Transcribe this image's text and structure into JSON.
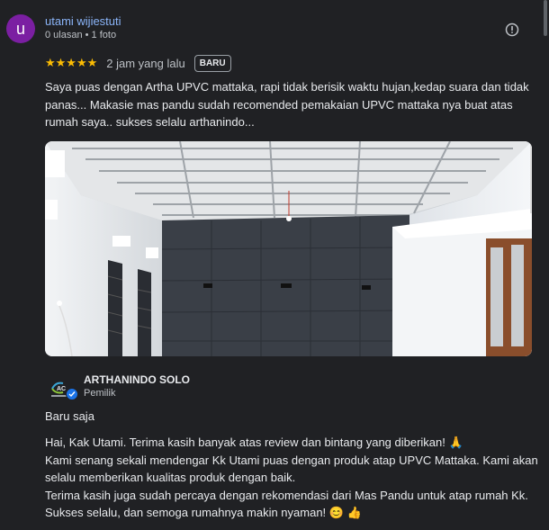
{
  "review": {
    "avatar_letter": "u",
    "reviewer_name": "utami wijiestuti",
    "reviewer_meta": "0 ulasan • 1 foto",
    "stars": "★★★★★",
    "rating": 5,
    "time_ago": "2 jam yang lalu",
    "badge": "BARU",
    "text": "Saya puas dengan Artha UPVC mattaka, rapi tidak berisik waktu hujan,kedap suara dan tidak panas... Makasie mas pandu sudah recomended pemakaian UPVC mattaka nya buat atas rumah saya.. sukses selalu arthanindo...",
    "more_icon": "info-circle-icon"
  },
  "owner_reply": {
    "name": "ARTHANINDO SOLO",
    "role": "Pemilik",
    "time": "Baru saja",
    "lines": [
      "Hai, Kak Utami. Terima kasih banyak atas review dan bintang yang diberikan! 🙏",
      "Kami senang sekali mendengar Kk Utami puas dengan produk atap UPVC Mattaka. Kami akan",
      "selalu memberikan kualitas produk dengan baik.",
      "Terima kasih juga sudah percaya dengan rekomendasi dari Mas Pandu untuk atap rumah Kk.",
      "Sukses selalu, dan semoga rumahnya makin nyaman! 😊 👍"
    ]
  },
  "colors": {
    "background": "#202124",
    "link": "#8ab4f8",
    "star": "#fbbc04",
    "avatar": "#7b1fa2"
  }
}
